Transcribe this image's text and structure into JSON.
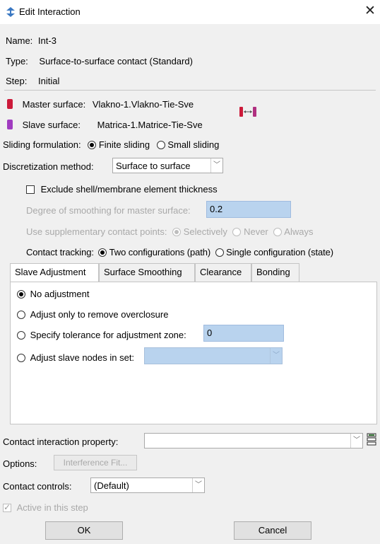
{
  "window": {
    "title": "Edit Interaction",
    "close_glyph": "✕"
  },
  "info": {
    "name_label": "Name:",
    "name_value": "Int-3",
    "type_label": "Type:",
    "type_value": "Surface-to-surface contact (Standard)",
    "step_label": "Step:",
    "step_value": "Initial"
  },
  "surfaces": {
    "master_label": "Master surface:",
    "master_value": "Vlakno-1.Vlakno-Tie-Sve",
    "slave_label": "Slave surface:",
    "slave_value": "Matrica-1.Matrice-Tie-Sve",
    "master_color": "#cc1a3a",
    "slave_color": "#a03bc0"
  },
  "sliding": {
    "label": "Sliding formulation:",
    "opt1": "Finite sliding",
    "opt2": "Small sliding",
    "selected": "Finite sliding"
  },
  "discretization": {
    "label": "Discretization method:",
    "value": "Surface to surface"
  },
  "exclude_thickness": {
    "label": "Exclude shell/membrane element thickness",
    "checked": false
  },
  "smoothing": {
    "label": "Degree of smoothing for master surface:",
    "value": "0.2"
  },
  "supplementary": {
    "label": "Use supplementary contact points:",
    "opt1": "Selectively",
    "opt2": "Never",
    "opt3": "Always"
  },
  "tracking": {
    "label": "Contact tracking:",
    "opt1": "Two configurations (path)",
    "opt2": "Single configuration (state)"
  },
  "tabs": [
    "Slave Adjustment",
    "Surface Smoothing",
    "Clearance",
    "Bonding"
  ],
  "slave_adjustment": {
    "opt_no": "No adjustment",
    "opt_remove": "Adjust only to remove overclosure",
    "opt_tolerance": "Specify tolerance for adjustment zone:",
    "tolerance_value": "0",
    "opt_nodes": "Adjust slave nodes in set:"
  },
  "property": {
    "label": "Contact interaction property:",
    "value": ""
  },
  "options": {
    "label": "Options:",
    "button": "Interference Fit..."
  },
  "controls": {
    "label": "Contact controls:",
    "value": "(Default)"
  },
  "active": {
    "label": "Active in this step",
    "checked": true
  },
  "buttons": {
    "ok": "OK",
    "cancel": "Cancel"
  },
  "colors": {
    "selection_blue": "#b9d3ee",
    "dialog_bg": "#f0f0f0"
  }
}
